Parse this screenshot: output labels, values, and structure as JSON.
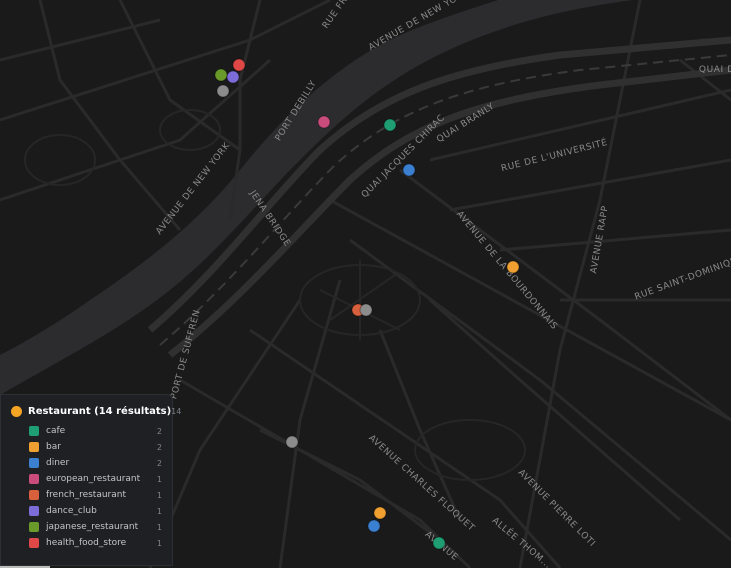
{
  "map": {
    "street_labels": [
      {
        "text": "AVENUE DE NEW YORK",
        "icon": ""
      },
      {
        "text": "AVENUE DE NEW YORK",
        "icon": ""
      },
      {
        "text": "RUE FR...",
        "icon": ""
      },
      {
        "text": "PORT DEBILLY",
        "icon": ""
      },
      {
        "text": "QUAI BRANLY",
        "icon": ""
      },
      {
        "text": "QUAI JACQUES CHIRAC",
        "icon": ""
      },
      {
        "text": "RUE DE L'UNIVERSITÉ",
        "icon": ""
      },
      {
        "text": "QUAI DE",
        "icon": ""
      },
      {
        "text": "JENA BRIDGE",
        "icon": ""
      },
      {
        "text": "AVENUE DE LA BOURDONNAIS",
        "icon": ""
      },
      {
        "text": "AVENUE RAPP",
        "icon": ""
      },
      {
        "text": "RUE SAINT-DOMINIQUE",
        "icon": ""
      },
      {
        "text": "PORT DE SUFFREN",
        "icon": ""
      },
      {
        "text": "AVENUE CHARLES FLOQUET",
        "icon": ""
      },
      {
        "text": "AVENUE PIERRE LOTI",
        "icon": ""
      },
      {
        "text": "ALLÉE THOM...",
        "icon": ""
      },
      {
        "text": "AVENUE",
        "icon": ""
      }
    ],
    "pois": [
      {
        "category": "cafe",
        "lat_rank": 1
      },
      {
        "category": "cafe",
        "lat_rank": 2
      },
      {
        "category": "bar",
        "lat_rank": 3
      },
      {
        "category": "bar",
        "lat_rank": 4
      },
      {
        "category": "diner",
        "lat_rank": 5
      },
      {
        "category": "diner",
        "lat_rank": 6
      },
      {
        "category": "european_restaurant",
        "lat_rank": 7
      },
      {
        "category": "french_restaurant",
        "lat_rank": 8
      },
      {
        "category": "dance_club",
        "lat_rank": 9
      },
      {
        "category": "japanese_restaurant",
        "lat_rank": 10
      },
      {
        "category": "health_food_store",
        "lat_rank": 11
      },
      {
        "category": "other",
        "lat_rank": 12
      },
      {
        "category": "other",
        "lat_rank": 13
      },
      {
        "category": "other",
        "lat_rank": 14
      }
    ],
    "colors": {
      "background": "#1a1a1b",
      "river": "#2c2c2e",
      "road": "#2a2a2b",
      "road_major": "#303031",
      "other_poi": "#8c8c8c"
    }
  },
  "legend": {
    "title": "Restaurant (14 résultats)",
    "total": "14",
    "accent": "#f5a524",
    "items": [
      {
        "label": "cafe",
        "count": "2",
        "color": "#1f9e74"
      },
      {
        "label": "bar",
        "count": "2",
        "color": "#f0a030"
      },
      {
        "label": "diner",
        "count": "2",
        "color": "#3b7fd0"
      },
      {
        "label": "european_restaurant",
        "count": "1",
        "color": "#c94c7c"
      },
      {
        "label": "french_restaurant",
        "count": "1",
        "color": "#d8603c"
      },
      {
        "label": "dance_club",
        "count": "1",
        "color": "#7c6cd8"
      },
      {
        "label": "japanese_restaurant",
        "count": "1",
        "color": "#6a9a2a"
      },
      {
        "label": "health_food_store",
        "count": "1",
        "color": "#e04848"
      }
    ]
  }
}
